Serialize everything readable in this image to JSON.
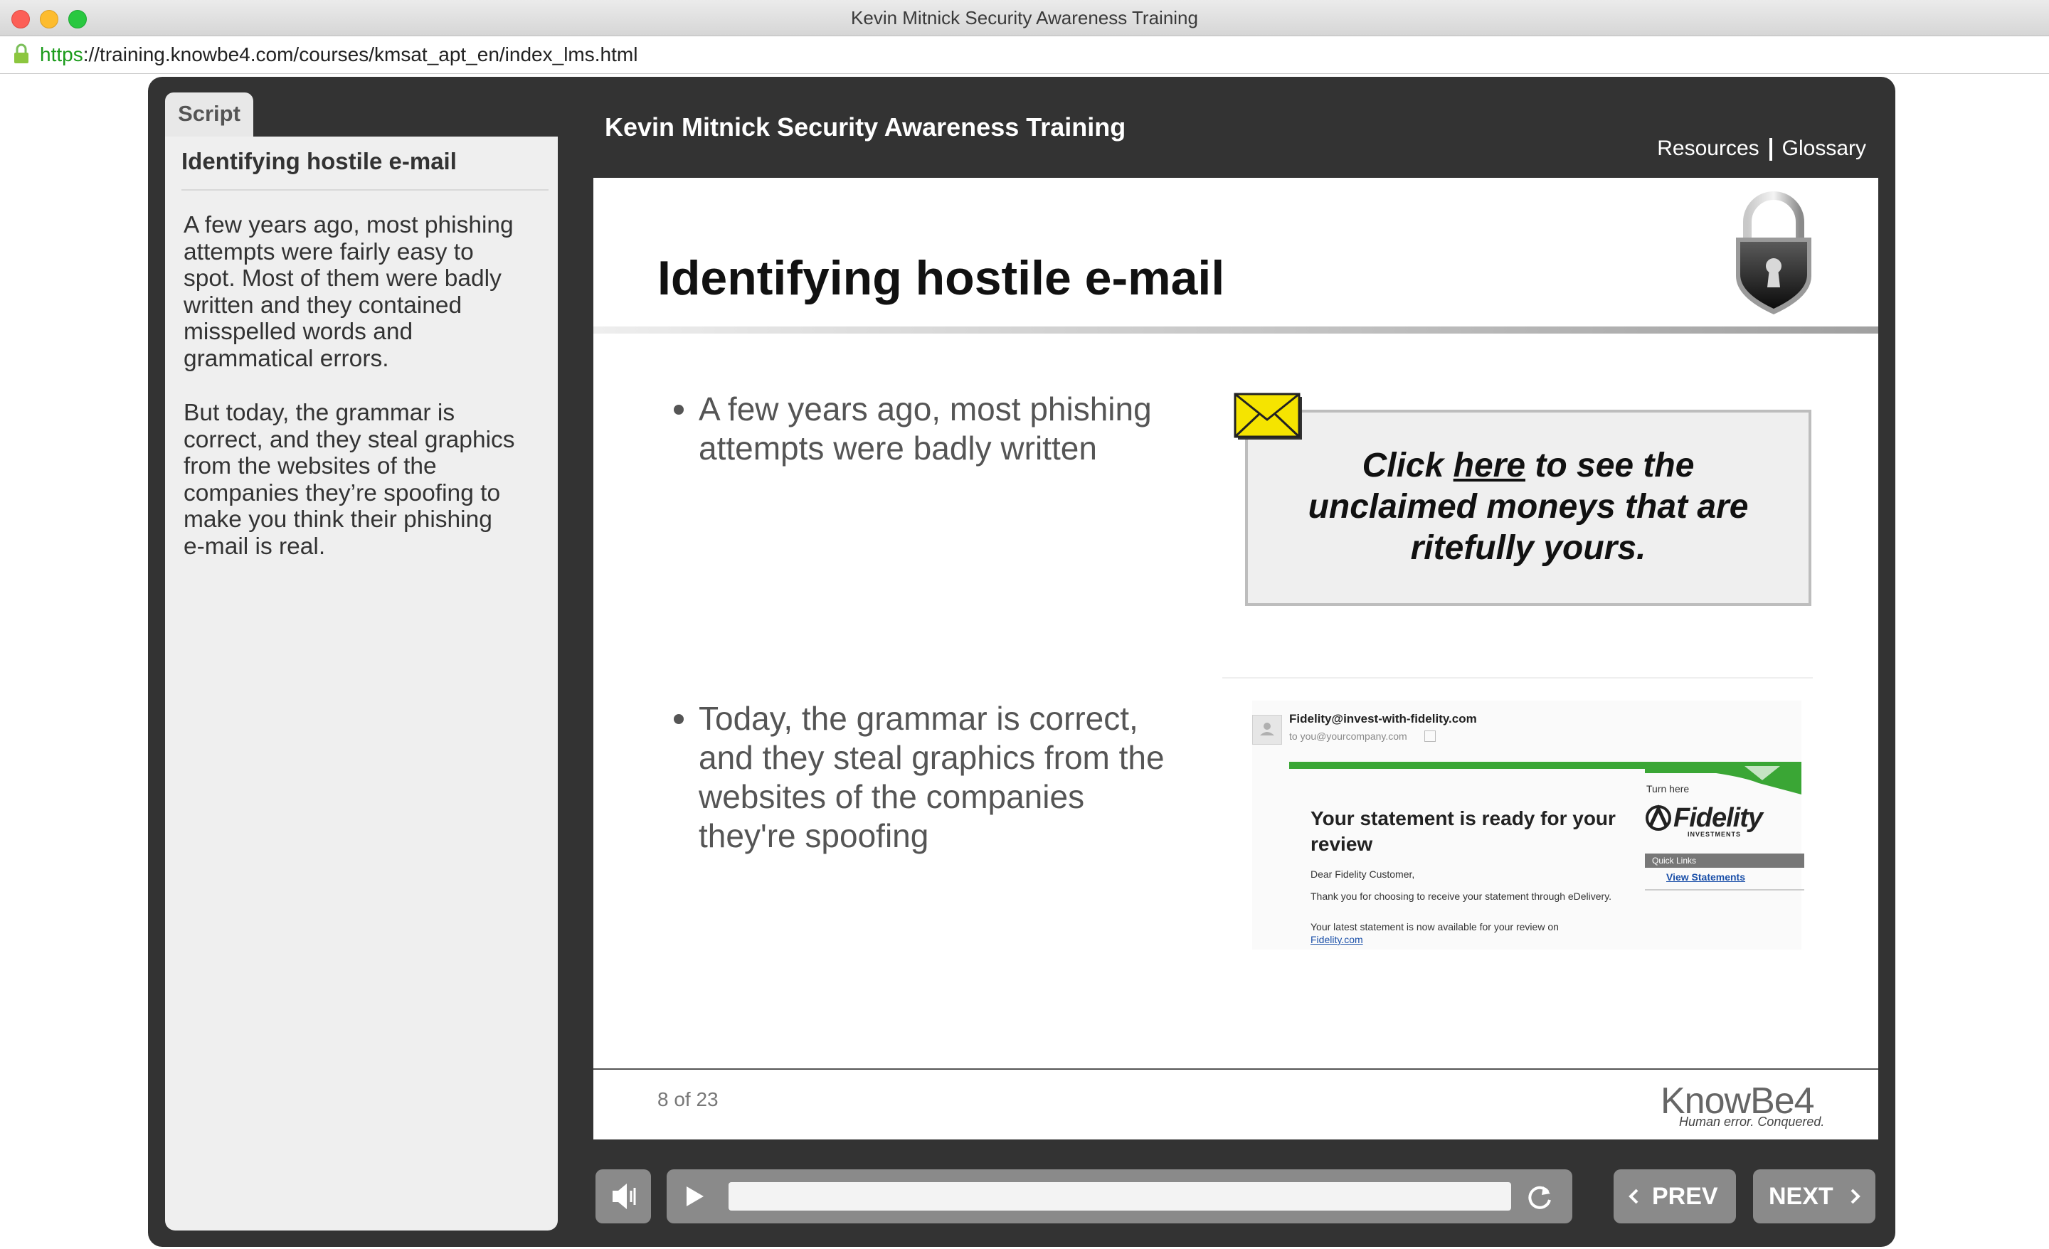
{
  "window": {
    "title": "Kevin Mitnick Security Awareness Training",
    "url_scheme": "https",
    "url_rest": "://training.knowbe4.com/courses/kmsat_apt_en/index_lms.html"
  },
  "script_panel": {
    "tab_label": "Script",
    "title": "Identifying hostile e-mail",
    "paragraphs": [
      [
        "A few years ago, most phishing",
        "attempts were fairly easy to",
        "spot. Most of them were badly",
        "written and they contained",
        "misspelled words and",
        "grammatical errors."
      ],
      [
        "But today, the grammar is",
        "correct, and they steal graphics",
        "from the websites of the",
        "companies they’re spoofing to",
        "make you think their phishing",
        "e-mail is real."
      ]
    ]
  },
  "header": {
    "course_title": "Kevin Mitnick Security Awareness Training",
    "resources_label": "Resources",
    "glossary_label": "Glossary"
  },
  "slide": {
    "heading": "Identifying hostile e-mail",
    "bullet1": [
      "A few years ago, most phishing",
      "attempts were badly written"
    ],
    "bullet2": [
      "Today, the grammar is correct,",
      "and they steal graphics from the",
      "websites of the companies",
      "they're spoofing"
    ],
    "phish_example": {
      "pre": "Click ",
      "link": "here",
      "post": " to see the",
      "line2": "unclaimed moneys that are",
      "line3": "ritefully yours."
    },
    "email_example": {
      "from": "Fidelity@invest-with-fidelity.com",
      "to": "to you@yourcompany.com",
      "headline1": "Your statement is ready for your",
      "headline2": "review",
      "turn_here": "Turn here",
      "brand": "Fidelity",
      "brand_sub": "INVESTMENTS",
      "greeting": "Dear Fidelity Customer,",
      "body1": "Thank you for choosing to receive your statement through eDelivery.",
      "body2": "Your latest statement is now available for your review on",
      "body_link": "Fidelity.com",
      "quick_links": "Quick Links",
      "view_statements": "View Statements"
    },
    "counter": "8 of 23",
    "logo_main": "KnowBe4",
    "logo_tagline": "Human error. Conquered."
  },
  "controls": {
    "prev_label": "PREV",
    "next_label": "NEXT",
    "progress": 0.0
  },
  "colors": {
    "frame": "#333333",
    "panel": "#efefef",
    "button": "#8a8a8a",
    "envelope": "#f5e400",
    "url_green": "#1a9b1a",
    "fidelity_green": "#3aa635"
  }
}
